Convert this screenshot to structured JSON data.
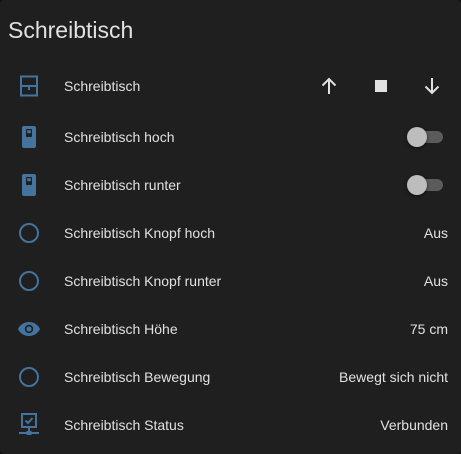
{
  "card": {
    "title": "Schreibtisch"
  },
  "colors": {
    "icon": "#44739e",
    "text": "#e1e1e1",
    "background": "#1f1f1f"
  },
  "rows": [
    {
      "icon": "window-shutter-icon",
      "label": "Schreibtisch",
      "control": "cover",
      "buttons": [
        "arrow-up-icon",
        "stop-icon",
        "arrow-down-icon"
      ]
    },
    {
      "icon": "light-switch-icon",
      "label": "Schreibtisch hoch",
      "control": "toggle",
      "state": "off"
    },
    {
      "icon": "light-switch-icon",
      "label": "Schreibtisch runter",
      "control": "toggle",
      "state": "off"
    },
    {
      "icon": "circle-outline-icon",
      "label": "Schreibtisch Knopf hoch",
      "value": "Aus"
    },
    {
      "icon": "circle-outline-icon",
      "label": "Schreibtisch Knopf runter",
      "value": "Aus"
    },
    {
      "icon": "eye-icon",
      "label": "Schreibtisch Höhe",
      "value": "75 cm"
    },
    {
      "icon": "circle-outline-icon",
      "label": "Schreibtisch Bewegung",
      "value": "Bewegt sich nicht"
    },
    {
      "icon": "monitor-network-icon",
      "label": "Schreibtisch Status",
      "value": "Verbunden"
    }
  ]
}
